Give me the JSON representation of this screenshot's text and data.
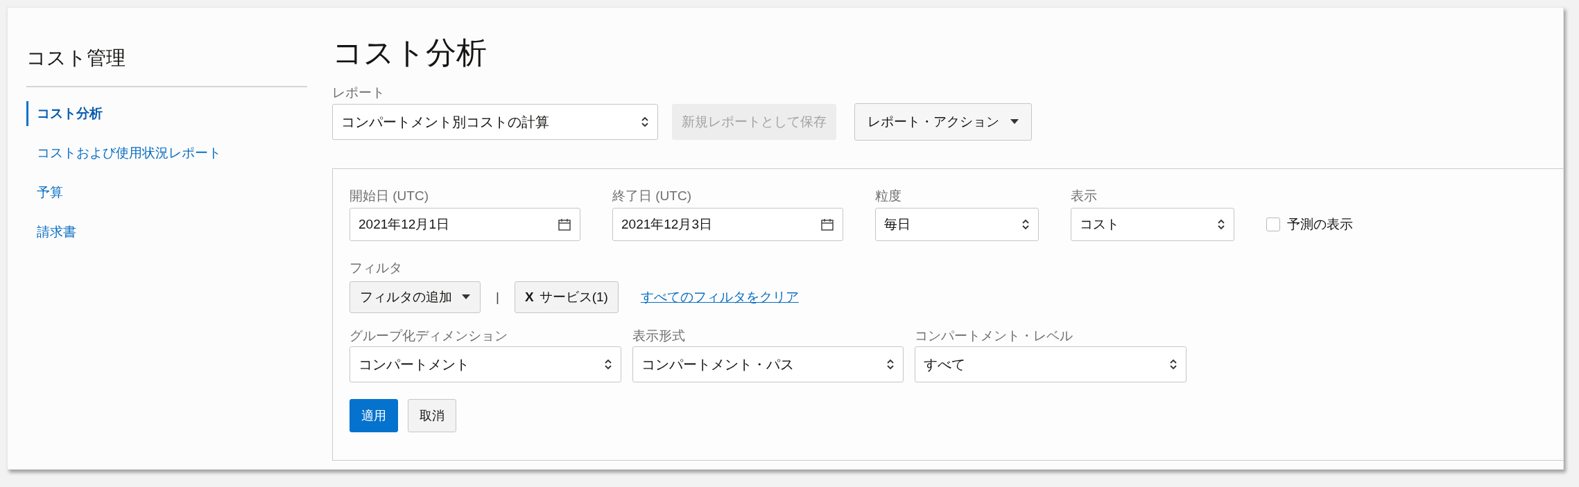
{
  "sidebar": {
    "title": "コスト管理",
    "items": [
      {
        "label": "コスト分析",
        "selected": true
      },
      {
        "label": "コストおよび使用状況レポート",
        "selected": false
      },
      {
        "label": "予算",
        "selected": false
      },
      {
        "label": "請求書",
        "selected": false
      }
    ]
  },
  "page_title": "コスト分析",
  "report": {
    "label": "レポート",
    "value": "コンパートメント別コストの計算",
    "save_button": {
      "label": "新規レポートとして保存",
      "disabled": true
    },
    "actions_button": "レポート・アクション"
  },
  "parameters": [
    {
      "kind": "date",
      "label": "開始日 (UTC)",
      "value": "2021年12月1日"
    },
    {
      "kind": "date",
      "label": "終了日 (UTC)",
      "value": "2021年12月3日"
    },
    {
      "kind": "select",
      "label": "粒度",
      "value": "毎日"
    },
    {
      "kind": "select",
      "label": "表示",
      "value": "コスト"
    },
    {
      "kind": "checkbox",
      "label": "予測の表示",
      "checked": false
    }
  ],
  "filters": {
    "label": "フィルタ",
    "add_button": "フィルタの追加",
    "separator": "|",
    "chips": [
      {
        "remove": "X",
        "label": "サービス(1)"
      }
    ],
    "clear_link": "すべてのフィルタをクリア"
  },
  "grouping": [
    {
      "label": "グループ化ディメンション",
      "value": "コンパートメント"
    },
    {
      "label": "表示形式",
      "value": "コンパートメント・パス"
    },
    {
      "label": "コンパートメント・レベル",
      "value": "すべて"
    }
  ],
  "buttons": [
    {
      "label": "適用",
      "kind": "primary"
    },
    {
      "label": "取消",
      "kind": "secondary"
    }
  ]
}
